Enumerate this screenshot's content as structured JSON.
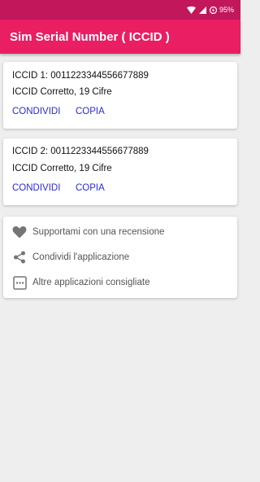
{
  "status_bar": {
    "battery_percent": "95%",
    "icons": [
      "wifi-icon",
      "signal-icon",
      "battery-icon"
    ]
  },
  "app_bar": {
    "title": "Sim Serial Number ( ICCID )"
  },
  "sim_cards": [
    {
      "iccid_line": "ICCID 1: 0011223344556677889",
      "status_line": "ICCID Corretto, 19 Cifre",
      "share_label": "CONDIVIDI",
      "copy_label": "COPIA"
    },
    {
      "iccid_line": "ICCID 2: 0011223344556677889",
      "status_line": "ICCID Corretto, 19 Cifre",
      "share_label": "CONDIVIDI",
      "copy_label": "COPIA"
    }
  ],
  "menu": {
    "items": [
      {
        "label": "Supportami con una recensione",
        "icon": "heart-icon"
      },
      {
        "label": "Condividi l'applicazione",
        "icon": "share-icon"
      },
      {
        "label": "Altre applicazioni consigliate",
        "icon": "more-apps-icon"
      }
    ]
  },
  "colors": {
    "primary": "#e91e63",
    "primary_dark": "#c2185b",
    "action_text": "#2a28e0",
    "background": "#eeeeee"
  }
}
